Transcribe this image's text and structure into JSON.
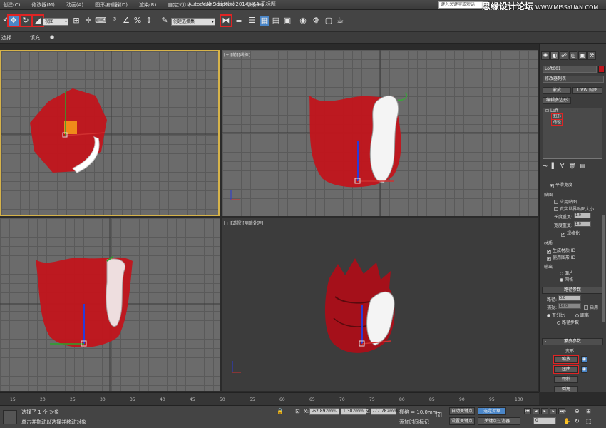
{
  "titlebar": {
    "menus": [
      "创建(C)",
      "修改器(M)",
      "动画(A)",
      "图形编辑器(D)",
      "渲染(R)",
      "自定义(U)",
      "MAXScript(X)",
      "帮助(H)"
    ],
    "app_title": "Autodesk 3ds Max  2014 x64     无标题",
    "search_placeholder": "键入关键字或短语",
    "brand": "思缘设计论坛",
    "brand_url": "WWW.MISSYUAN.COM"
  },
  "toolbar": {
    "view_select": "视图",
    "named_selection": "创建选择集"
  },
  "ribbon": {
    "items": [
      "选择",
      "填充"
    ]
  },
  "viewports": {
    "top_right": {
      "label_a": "[+]",
      "label_b": "[前]",
      "label_c": "[线框]"
    },
    "bottom_right": {
      "label_a": "[+]",
      "label_b": "[透视]",
      "label_c": "[明暗处理]"
    }
  },
  "command_panel": {
    "object_name": "Loft001",
    "object_color": "#c0141c",
    "modifier_list": "修改器列表",
    "btn_skin": "蒙皮",
    "btn_uvw": "UVW 贴图",
    "btn_edit_poly": "编辑多边形",
    "stack_root": "Loft",
    "stack_shape": "图形",
    "stack_path": "路径",
    "smooth_width": "平滑宽度",
    "mapping_title": "贴图",
    "apply_mapping": "应用贴图",
    "real_world": "真实世界贴图大小",
    "length_repeat": "长度重复:",
    "width_repeat": "宽度重复:",
    "repeat_val": "1.0",
    "normalize": "规格化",
    "materials_title": "材质",
    "gen_material_ids": "生成材质 ID",
    "use_shape_ids": "使用图形 ID",
    "output_title": "输出",
    "output_patch": "面片",
    "output_mesh": "网格",
    "path_params": "路径参数",
    "path_label": "路径:",
    "path_val": "0.0",
    "snap_label": "捕捉:",
    "snap_val": "10.0",
    "snap_enable": "启用",
    "percent": "百分比",
    "distance": "距离",
    "path_steps": "路径步数",
    "skin_params": "蒙皮参数",
    "deform_title": "变形",
    "scale_btn": "缩放",
    "twist_btn": "扭曲",
    "teeter_btn": "倾斜",
    "bevel_btn": "倒角"
  },
  "timeline": {
    "ticks": [
      "15",
      "20",
      "25",
      "30",
      "35",
      "40",
      "45",
      "50",
      "55",
      "60",
      "65",
      "70",
      "75",
      "80",
      "85",
      "90",
      "95",
      "100"
    ]
  },
  "statusbar": {
    "message1": "选择了 1 个 对象",
    "message2": "单击并拖动以选择并移动对象",
    "x_label": "X:",
    "x_val": "-62.892mm",
    "y_label": "Y:",
    "y_val": "1.302mm",
    "z_label": "Z:",
    "z_val": "-77.782mm",
    "grid": "栅格 = 10.0mm",
    "add_time_tag": "添加时间标记",
    "auto_key": "自动关键点",
    "set_key": "设置关键点",
    "selected": "选定对象",
    "key_filters": "关键点过滤器...",
    "frame": "0"
  }
}
